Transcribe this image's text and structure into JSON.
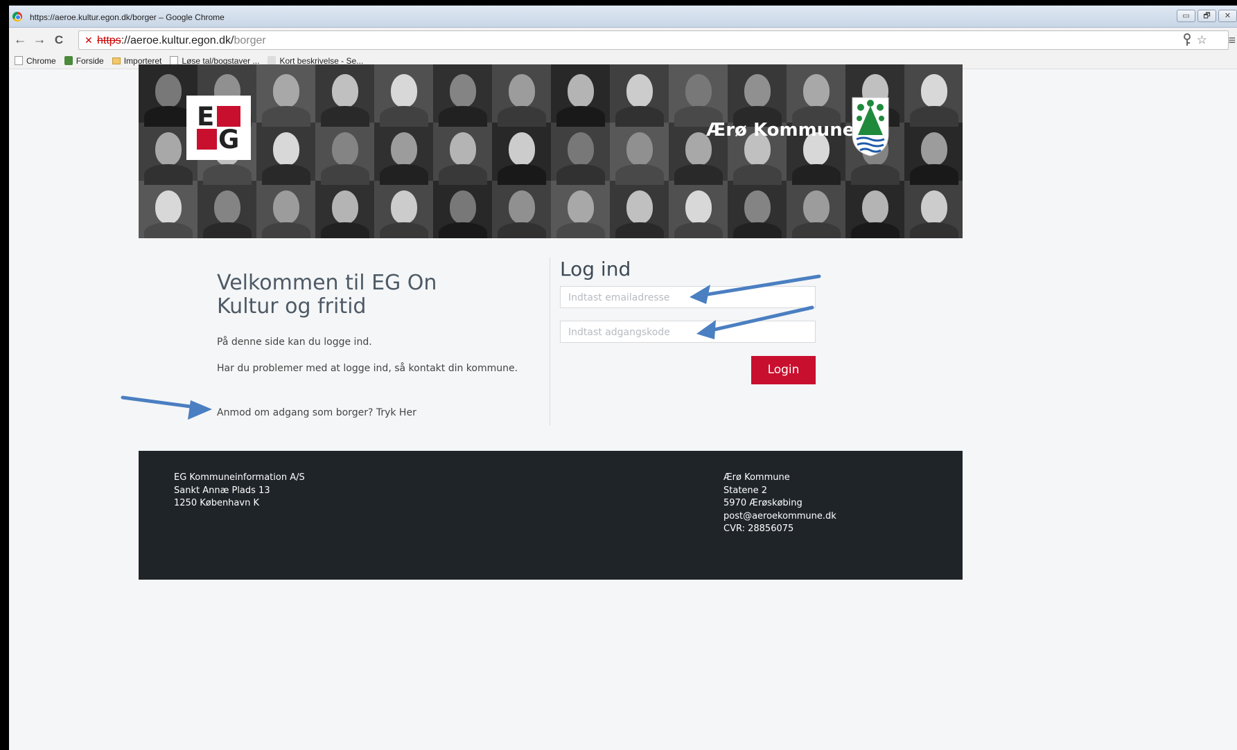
{
  "window": {
    "title": "https://aeroe.kultur.egon.dk/borger – Google Chrome",
    "controls": {
      "minimize": "▭",
      "restore": "🗗",
      "close": "✕"
    }
  },
  "browser": {
    "url_scheme": "https",
    "url_host": "://aeroe.kultur.egon.dk/",
    "url_path": "borger",
    "nav": {
      "back": "←",
      "forward": "→",
      "reload": "C"
    },
    "icons": {
      "key": "key-icon",
      "star": "☆",
      "menu": "≡"
    },
    "bookmarks": [
      {
        "label": "Chrome",
        "icon": "page-icon"
      },
      {
        "label": "Forside",
        "icon": "leaf-icon"
      },
      {
        "label": "Importeret",
        "icon": "folder-icon"
      },
      {
        "label": "Løse tal/bogstaver ...",
        "icon": "page-icon"
      },
      {
        "label": "Kort beskrivelse - Se...",
        "icon": "w-icon"
      }
    ]
  },
  "banner": {
    "logo_letters": [
      "E",
      "G"
    ],
    "title": "Ærø Kommune",
    "brand_color": "#c8102e"
  },
  "main": {
    "welcome": "Velkommen til EG On Kultur og fritid",
    "paragraph1": "På denne side kan du logge ind.",
    "paragraph2": "Har du problemer med at logge ind, så kontakt din kommune.",
    "request_access": "Anmod om adgang som borger? Tryk Her"
  },
  "login": {
    "title": "Log ind",
    "email_placeholder": "Indtast emailadresse",
    "password_placeholder": "Indtast adgangskode",
    "button": "Login"
  },
  "footer": {
    "left": [
      "EG Kommuneinformation A/S",
      "Sankt Annæ Plads 13",
      "1250 København K"
    ],
    "right": [
      "Ærø Kommune",
      "Statene 2",
      "5970 Ærøskøbing",
      "post@aeroekommune.dk",
      "CVR: 28856075"
    ]
  }
}
